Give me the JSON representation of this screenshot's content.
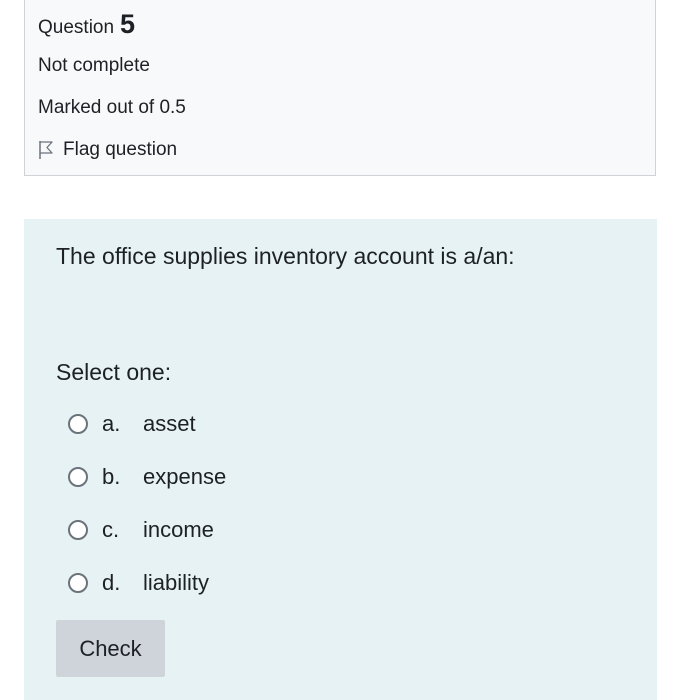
{
  "question_info": {
    "label": "Question",
    "number": "5",
    "state": "Not complete",
    "grade": "Marked out of 0.5",
    "flag_label": "Flag question"
  },
  "question": {
    "text": "The office supplies inventory account is a/an:",
    "prompt": "Select one:",
    "answers": [
      {
        "letter": "a.",
        "label": "asset"
      },
      {
        "letter": "b.",
        "label": "expense"
      },
      {
        "letter": "c.",
        "label": "income"
      },
      {
        "letter": "d.",
        "label": "liability"
      }
    ],
    "check_label": "Check"
  },
  "colors": {
    "info_bg": "#f8f9fa",
    "content_bg": "#e7f2f5",
    "button_bg": "#ced4da"
  },
  "icons": {
    "flag": "flag-icon",
    "radio": "radio-button"
  }
}
